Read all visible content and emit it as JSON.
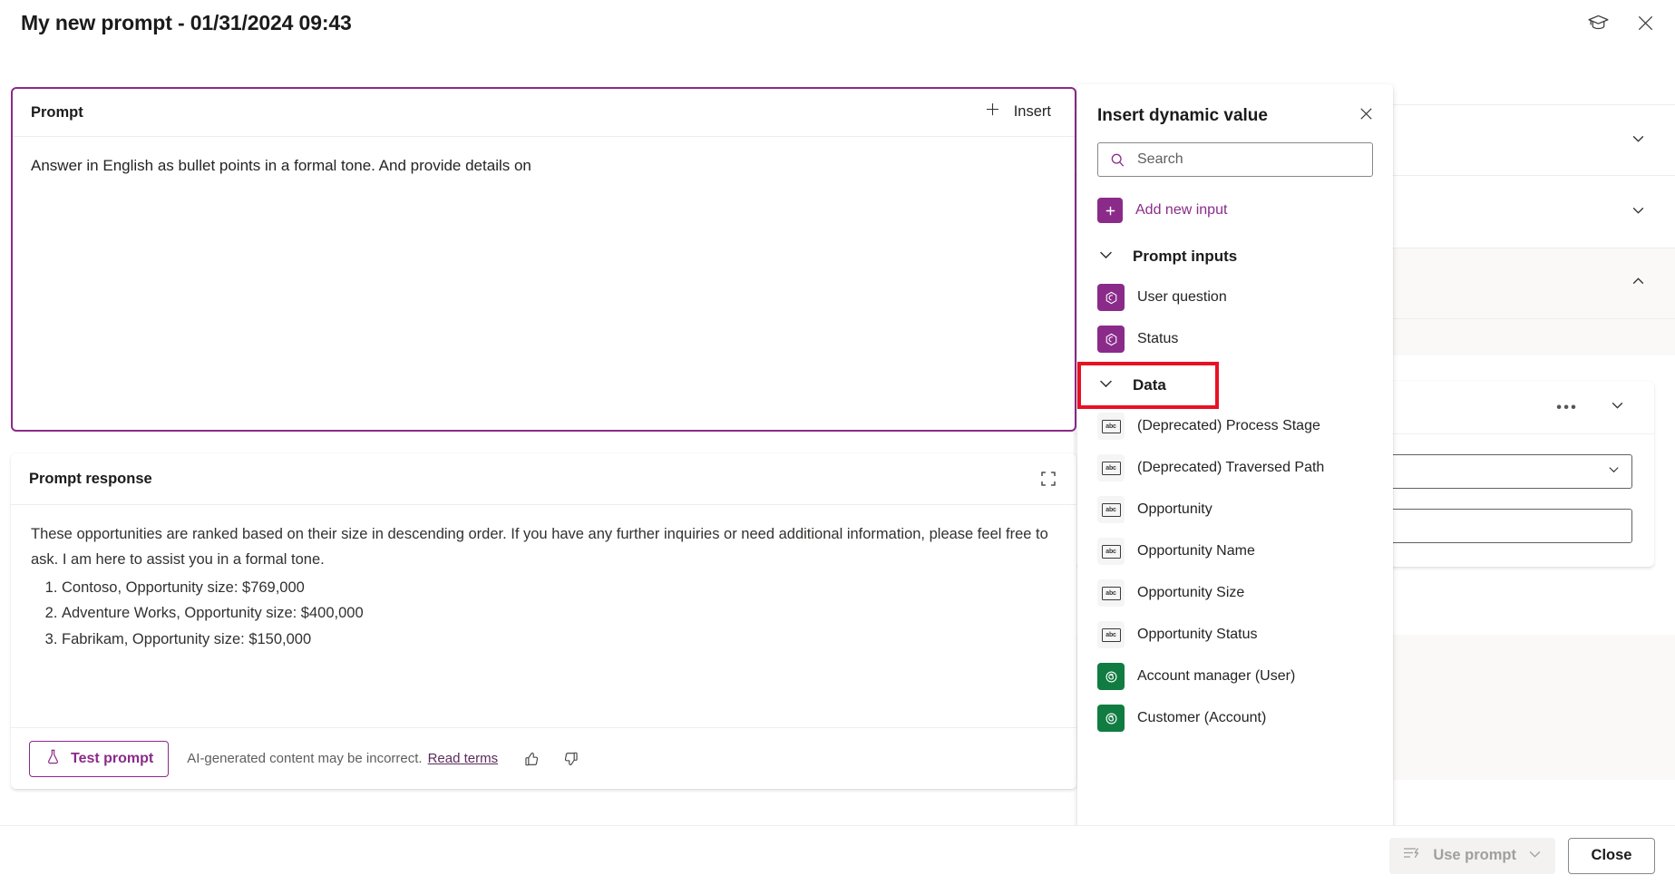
{
  "window": {
    "title": "My new prompt - 01/31/2024 09:43",
    "learn_icon": "graduation-cap-icon",
    "close_icon": "close-icon"
  },
  "prompt_card": {
    "header_label": "Prompt",
    "insert_label": "Insert",
    "insert_icon": "plus-icon",
    "body_text": "Answer in English as bullet points in a formal tone. And provide details on"
  },
  "response_card": {
    "header_label": "Prompt response",
    "expand_icon": "expand-icon",
    "paragraph": "These opportunities are ranked based on their size in descending order. If you have any further inquiries or need additional information, please feel free to ask. I am here to assist you in a formal tone.",
    "items": [
      "Contoso, Opportunity size: $769,000",
      "Adventure Works, Opportunity size: $400,000",
      "Fabrikam, Opportunity size: $150,000"
    ],
    "test_button": "Test prompt",
    "test_icon": "flask-icon",
    "disclaimer": "AI-generated content may be incorrect.",
    "read_terms": "Read terms",
    "thumbs_up_icon": "thumbs-up-icon",
    "thumbs_down_icon": "thumbs-down-icon"
  },
  "dynamic_panel": {
    "title": "Insert dynamic value",
    "close_icon": "close-icon",
    "search_placeholder": "Search",
    "search_value": "",
    "search_icon": "search-icon",
    "add_new_input": "Add new input",
    "add_icon": "plus-icon",
    "groups": [
      {
        "label": "Prompt inputs",
        "expanded": true,
        "chevron_icon": "chevron-down-icon",
        "highlighted": false,
        "items": [
          {
            "label": "User question",
            "icon": "dynamic-value-icon",
            "icon_style": "purple"
          },
          {
            "label": "Status",
            "icon": "dynamic-value-icon",
            "icon_style": "purple"
          }
        ]
      },
      {
        "label": "Data",
        "expanded": true,
        "chevron_icon": "chevron-down-icon",
        "highlighted": true,
        "items": [
          {
            "label": "(Deprecated) Process Stage",
            "icon": "text-field-icon",
            "icon_style": "grey",
            "glyph": "abc"
          },
          {
            "label": "(Deprecated) Traversed Path",
            "icon": "text-field-icon",
            "icon_style": "grey",
            "glyph": "abc"
          },
          {
            "label": "Opportunity",
            "icon": "text-field-icon",
            "icon_style": "grey",
            "glyph": "abc"
          },
          {
            "label": "Opportunity Name",
            "icon": "text-field-icon",
            "icon_style": "grey",
            "glyph": "abc"
          },
          {
            "label": "Opportunity Size",
            "icon": "text-field-icon",
            "icon_style": "grey",
            "glyph": "abc"
          },
          {
            "label": "Opportunity Status",
            "icon": "text-field-icon",
            "icon_style": "grey",
            "glyph": "abc"
          },
          {
            "label": "Account manager (User)",
            "icon": "lookup-field-icon",
            "icon_style": "green"
          },
          {
            "label": "Customer (Account)",
            "icon": "lookup-field-icon",
            "icon_style": "green"
          }
        ]
      }
    ]
  },
  "footer": {
    "use_prompt_label": "Use prompt",
    "use_prompt_icon": "use-prompt-icon",
    "use_prompt_chevron": "chevron-down-icon",
    "close_label": "Close"
  },
  "colors": {
    "accent_purple": "#8a2b8a",
    "highlight_red": "#e81123",
    "lookup_green": "#107c41"
  }
}
